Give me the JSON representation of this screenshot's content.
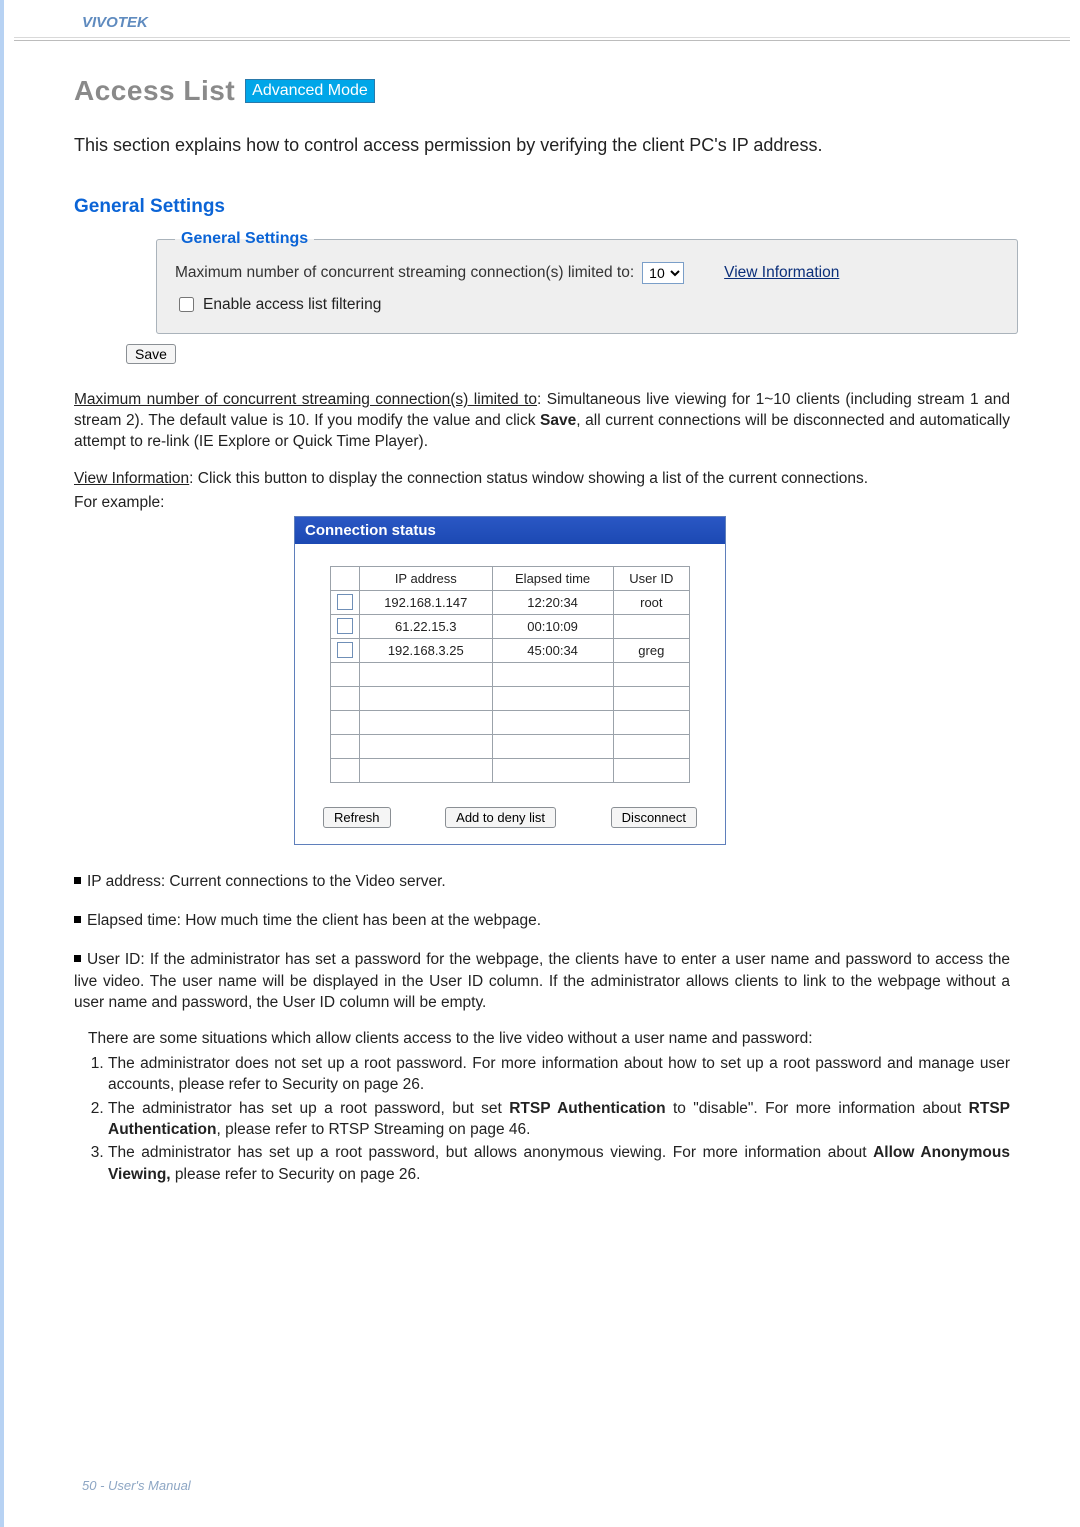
{
  "brand": "VIVOTEK",
  "title": "Access List",
  "mode_badge": "Advanced Mode",
  "intro": "This section explains how to control access permission by verifying the client PC's IP address.",
  "section_heading": "General Settings",
  "general": {
    "legend": "General Settings",
    "max_label": "Maximum number of concurrent streaming connection(s) limited to:",
    "max_value": "10",
    "view_info": "View Information",
    "enable_filtering": "Enable access list filtering",
    "save": "Save"
  },
  "body": {
    "max_heading": "Maximum number of concurrent streaming connection(s) limited to",
    "max_text_a": ": Simultaneous live viewing for 1~10 clients (including stream 1 and stream 2). The default value is 10. If you modify the value and click ",
    "max_text_save": "Save",
    "max_text_b": ", all current connections will be disconnected and automatically attempt to re-link (IE Explore or Quick Time Player).",
    "view_heading": "View Information",
    "view_text": ": Click this button to display the connection status window showing a list of the current connections.",
    "for_example": "For example:"
  },
  "conn": {
    "title": "Connection status",
    "headers": {
      "ip": "IP address",
      "elapsed": "Elapsed time",
      "user": "User ID"
    },
    "rows": [
      {
        "ip": "192.168.1.147",
        "elapsed": "12:20:34",
        "user": "root"
      },
      {
        "ip": "61.22.15.3",
        "elapsed": "00:10:09",
        "user": ""
      },
      {
        "ip": "192.168.3.25",
        "elapsed": "45:00:34",
        "user": "greg"
      }
    ],
    "empty_rows": 5,
    "buttons": {
      "refresh": "Refresh",
      "add_deny": "Add to deny list",
      "disconnect": "Disconnect"
    }
  },
  "bullets": {
    "ip": "IP address: Current connections to the Video server.",
    "elapsed": "Elapsed time: How much time the client has been at the webpage.",
    "userid": "User ID: If the administrator has set a password for the webpage, the clients have to enter a user name and password to access the live video. The user name will be displayed in the User ID column. If the administrator allows clients to link to the webpage without a user name and password, the User ID column will be empty.",
    "situations": "There are some situations which allow clients access to the live video without a user name and password:",
    "s1": "The administrator does not set up a root password. For more information about how to set up a root password and manage user accounts, please refer to Security on page 26.",
    "s2a": "The administrator has set up a root password, but set ",
    "s2b": "RTSP Authentication",
    "s2c": " to \"disable\". For more information about ",
    "s2d": "RTSP Authentication",
    "s2e": ", please refer to RTSP Streaming on page 46.",
    "s3a": "The administrator has set up a root password, but allows anonymous viewing. For more information about ",
    "s3b": "Allow Anonymous Viewing,",
    "s3c": " please refer to Security on page 26."
  },
  "footer": "50 - User's Manual"
}
